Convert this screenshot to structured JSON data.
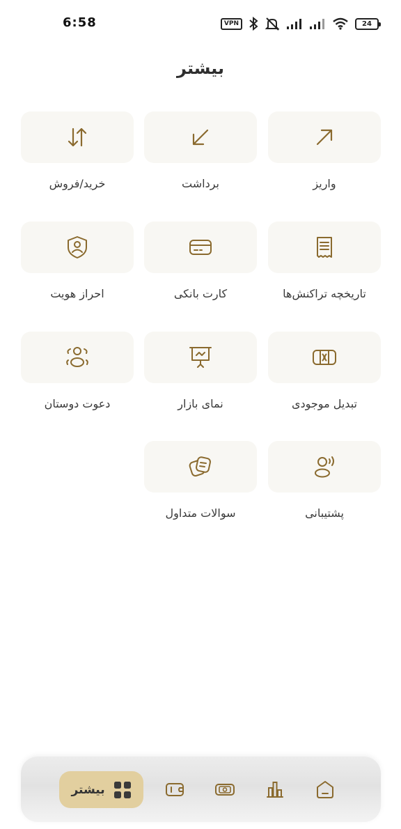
{
  "status_bar": {
    "time": "6:58",
    "vpn": "VPN",
    "battery": "24",
    "icons": [
      "vpn-icon",
      "bluetooth-icon",
      "mute-icon",
      "signal-icon",
      "signal-icon",
      "wifi-icon",
      "battery-icon"
    ]
  },
  "header": {
    "title": "بیشتر"
  },
  "menu": {
    "deposit": "واریز",
    "withdraw": "برداشت",
    "buy_sell": "خرید/فروش",
    "history": "تاریخچه تراکنش‌ها",
    "bank_card": "کارت بانکی",
    "kyc": "احراز هویت",
    "convert": "تبدیل موجودی",
    "market": "نمای بازار",
    "invite": "دعوت دوستان",
    "support": "پشتیبانی",
    "faq": "سوالات متداول"
  },
  "bottom_nav": {
    "active_label": "بیشتر",
    "items": [
      "home-icon",
      "chart-icon",
      "cash-icon",
      "wallet-icon",
      "grid-icon"
    ]
  },
  "colors": {
    "accent": "#8a6a2e",
    "tile_bg": "#f8f7f3",
    "active_tab": "#e2cf9f"
  }
}
